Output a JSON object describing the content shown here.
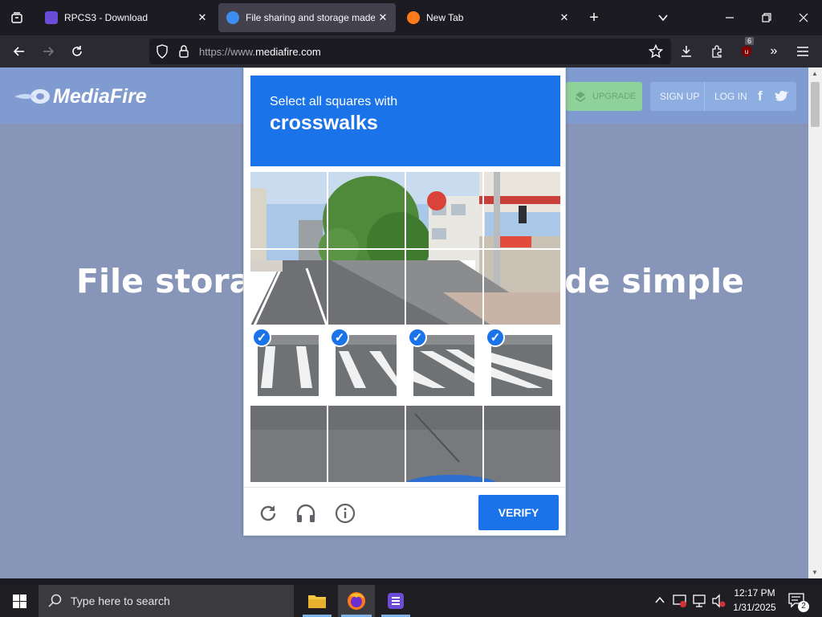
{
  "browser": {
    "tabs": [
      {
        "title": "RPCS3 - Download",
        "active": false
      },
      {
        "title": "File sharing and storage made simple",
        "active": true
      },
      {
        "title": "New Tab",
        "active": false
      }
    ],
    "url_prefix": "https://www.",
    "url_domain": "mediafire.com",
    "extension_badge": "6"
  },
  "site": {
    "logo": "MediaFire",
    "upgrade": "UPGRADE",
    "signup": "SIGN UP",
    "login": "LOG IN",
    "hero_left": "File storag",
    "hero_right": "de simple"
  },
  "captcha": {
    "prompt": "Select all squares with",
    "target": "crosswalks",
    "selected_tiles": [
      4,
      5,
      6,
      7
    ],
    "verify": "VERIFY"
  },
  "taskbar": {
    "search_placeholder": "Type here to search",
    "time": "12:17 PM",
    "date": "1/31/2025",
    "notifications": "2"
  },
  "colors": {
    "accent": "#1a73e8",
    "page_overlay": "#8796b8",
    "header": "#7f9bd0",
    "upgrade_bg": "#8fd19a"
  }
}
